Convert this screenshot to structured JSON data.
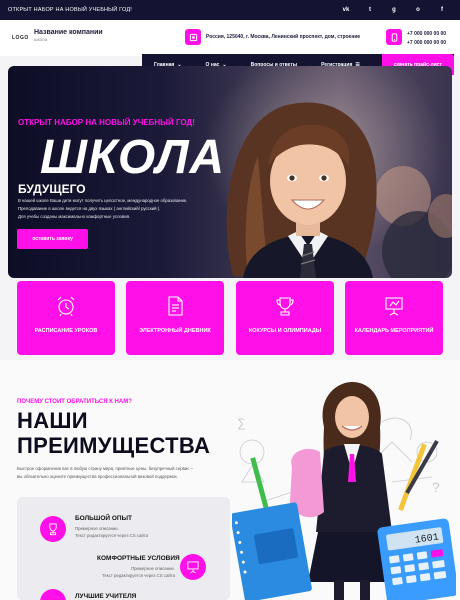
{
  "topbar": {
    "announcement": "ОТКРЫТ НАБОР НА НОВЫЙ УЧЕБНЫЙ ГОД!",
    "socials": [
      {
        "icon": "vk-icon",
        "glyph": "vk"
      },
      {
        "icon": "twitter-icon",
        "glyph": "t"
      },
      {
        "icon": "google-icon",
        "glyph": "g"
      },
      {
        "icon": "odnoklassniki-icon",
        "glyph": "o"
      },
      {
        "icon": "facebook-icon",
        "glyph": "f"
      }
    ]
  },
  "header": {
    "logo": "LOGO",
    "company_name": "Название компании",
    "company_sub": "школа",
    "address": "Россия, 125040, г. Москва, Ленинский проспект, дом, строение",
    "phones": [
      "+7 000 000 00 00",
      "+7 000 000 00 00"
    ]
  },
  "nav": {
    "items": [
      {
        "label": "Главная",
        "chevron": "⌄"
      },
      {
        "label": "О нас",
        "chevron": "⌄"
      },
      {
        "label": "Вопросы и ответы",
        "chevron": ""
      },
      {
        "label": "Регистрация",
        "chevron": "☰"
      }
    ],
    "price_button": "скачать прайс-лист"
  },
  "hero": {
    "kicker": "ОТКРЫТ НАБОР НА НОВЫЙ УЧЕБНЫЙ ГОД!",
    "title": "ШКОЛА",
    "subtitle": "БУДУЩЕГО",
    "description": [
      "В нашей школе Ваши дети могут получить целостное, международное образование.",
      "Преподавание в школе ведется на двух языках ( английский/ русский ).",
      "Для учебы созданы максимально комфортные условия."
    ],
    "cta": "оставить заявку"
  },
  "cards": [
    {
      "icon": "alarm-clock-icon",
      "label": "РАСПИСАНИЕ УРОКОВ"
    },
    {
      "icon": "document-icon",
      "label": "ЭЛЕКТРОННЫЙ ДНЕВНИК"
    },
    {
      "icon": "trophy-icon",
      "label": "КОКУРСЫ И ОЛИМПИАДЫ"
    },
    {
      "icon": "presentation-board-icon",
      "label": "КАЛЕНДАРЬ МЕРОПРИЯТИЙ"
    }
  ],
  "advantages": {
    "why": "ПОЧЕМУ СТОИТ ОБРАТИТЬСЯ К НАМ?",
    "title_line1": "НАШИ",
    "title_line2": "ПРЕИМУЩЕСТВА",
    "description": [
      "Быстрое оформление вас в любую страну мира, приятные цены, безупречный сервис –",
      "вы обязательно оцените преимущества профессиональной визовой поддержки."
    ],
    "items": [
      {
        "icon": "trophy-icon",
        "title": "БОЛЬШОЙ ОПЫТ",
        "text": [
          "Примерное описание.",
          "Текст редактируется через CS сайта"
        ]
      },
      {
        "icon": "presentation-board-icon",
        "title": "КОМФОРТНЫЕ УСЛОВИЯ",
        "text": [
          "Примерное описание.",
          "Текст редактируется через CS сайта"
        ]
      },
      {
        "icon": "person-icon",
        "title": "ЛУЧШИЕ УЧИТЕЛЯ",
        "text": []
      }
    ]
  },
  "calculator": {
    "display": "1601"
  },
  "colors": {
    "accent": "#ff10e8",
    "dark": "#141432"
  }
}
